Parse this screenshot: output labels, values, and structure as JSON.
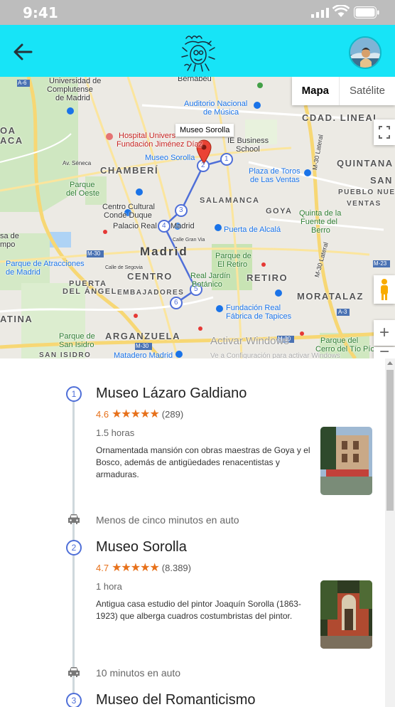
{
  "status_bar": {
    "time": "9:41"
  },
  "map": {
    "map_type": {
      "map_label": "Mapa",
      "satellite_label": "Satélite"
    },
    "tooltip": "Museo Sorolla",
    "labels": {
      "universidad": "Universidad de",
      "complutense": "Complutense",
      "de_madrid": "de Madrid",
      "bernabeu": "Bernabéu",
      "auditorio": "Auditorio Nacional",
      "de_musica": "de Música",
      "cdad_lineal": "CDAD. LINEAL",
      "oa": "OA",
      "aca": "ACA",
      "hospital": "Hospital Univers",
      "fundacion": "Fundación Jiménez Díaz",
      "ie_business": "IE Business",
      "school": "School",
      "museo_sorolla": "Museo Sorolla",
      "av_seneca": "Av. Séneca",
      "chamberi": "CHAMBERÍ",
      "quintana": "QUINTANA",
      "plaza_toros": "Plaza de Toros",
      "de_las_ventas": "de Las Ventas",
      "san": "SAN",
      "pueblo_nuev": "PUEBLO NUEV",
      "ventas": "VENTAS",
      "parque_del": "Parque",
      "del_oeste": "del Oeste",
      "salamanca": "SALAMANCA",
      "goya": "GOYA",
      "quinta_de_la": "Quinta de la",
      "fuente_del": "Fuente del",
      "berro": "Berro",
      "centro_cultural": "Centro Cultural",
      "conde_duque": "Conde Duque",
      "palacio_real": "Palacio Real",
      "madrid_label": "Madrid",
      "puerta_alcala": "Puerta de Alcalá",
      "sa_de": "sa de",
      "mpo": "mpo",
      "calle_gran_via": "Calle Gran Via",
      "city": "Madrid",
      "parque_del_retiro_1": "Parque de",
      "parque_del_retiro_2": "El Retiro",
      "parque_atracciones_1": "Parque de Atracciones",
      "parque_atracciones_2": "de Madrid",
      "calle_segovia": "Calle de Segovia",
      "centro": "CENTRO",
      "real_jardin_1": "Real Jardín",
      "real_jardin_2": "Botánico",
      "retiro": "RETIRO",
      "puerta_del_angel_1": "PUERTA",
      "puerta_del_angel_2": "DEL ÁNGEL",
      "embajadores": "EMBAJADORES",
      "moratalaz": "MORATALAZ",
      "fundacion_real_1": "Fundación Real",
      "fundacion_real_2": "Fábrica de Tapices",
      "atina": "ATINA",
      "arganzuela": "ARGANZUELA",
      "parque_san_isidro_1": "Parque de",
      "parque_san_isidro_2": "San Isidro",
      "matadero": "Matadero Madrid",
      "parque_cerro_1": "Parque del",
      "parque_cerro_2": "Cerro del Tío Pío",
      "activar_windows": "Activar Windows",
      "ve_a_config": "Ve a Configuración para activar Windows",
      "m30_lateral": "M-30 Lateral",
      "m30": "M-30",
      "m23": "M-23",
      "a3": "A-3",
      "a6": "A-6",
      "m40": "M-30"
    },
    "route_markers": [
      "1",
      "2",
      "3",
      "4",
      "5",
      "6"
    ],
    "controls": {
      "zoom_in": "+",
      "zoom_out": "−"
    }
  },
  "itinerary": [
    {
      "number": "1",
      "title": "Museo Lázaro Galdiano",
      "rating": "4.6",
      "stars": "★★★★★",
      "reviews": "(289)",
      "duration": "1.5 horas",
      "description": "Ornamentada mansión con obras maestras de Goya y el Bosco, además de antigüedades renacentistas y armaduras.",
      "travel_after": "Menos de cinco minutos en auto"
    },
    {
      "number": "2",
      "title": "Museo Sorolla",
      "rating": "4.7",
      "stars": "★★★★★",
      "reviews": "(8.389)",
      "duration": "1 hora",
      "description": "Antigua casa estudio del pintor Joaquín Sorolla (1863-1923) que alberga cuadros costumbristas del pintor.",
      "travel_after": "10 minutos en auto"
    },
    {
      "number": "3",
      "title": "Museo del Romanticismo"
    }
  ],
  "colors": {
    "app_bar": "#17e4f7",
    "route": "#4f6fd8",
    "accent_rating": "#e7711b"
  }
}
